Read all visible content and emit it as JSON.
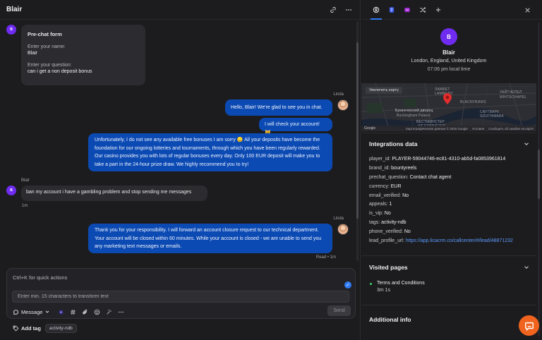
{
  "chat": {
    "title": "Blair",
    "visitor_initial": "B",
    "prechat": {
      "title": "Pre-chat form",
      "name_label": "Enter your name:",
      "name_value": "Blair",
      "question_label": "Enter your question:",
      "question_value": "can i get a non deposit bonus"
    },
    "messages": [
      {
        "sender": "Linda",
        "text": "Hello, Blair! We're glad to see you in chat."
      },
      {
        "text": "I will check your account! 😺"
      },
      {
        "text": "Unfortunately, I do not see any available free bonuses I am sorry 😞 All your deposits have become the foundation for our ongoing lotteries and tournaments, through which you have been regularly rewarded. Our casino provides you with lots of regular bonuses every day. Only 100 EUR deposit will make you to take a part in the 24-hour prize draw. We highly recommend you to try!"
      },
      {
        "sender": "Blair",
        "text": "ban my account i have a gambling problem and stop sending me messages",
        "time": "1m"
      },
      {
        "sender": "Linda",
        "text": "Thank you for your responsibility. I will forward an account closure request to our technical department. Your account will be closed within 60 minutes. While your account is closed - we are unable to send you any marketing text messages or emails.",
        "status": "Read • 1m"
      }
    ]
  },
  "composer": {
    "hint": "Ctrl+K for quick actions",
    "transform_placeholder": "Enter min. 15 characters to transform text",
    "mode_label": "Message",
    "send_label": "Send",
    "add_tag_label": "Add tag",
    "tag": "activity-ndb"
  },
  "profile": {
    "initial": "B",
    "name": "Blair",
    "location": "London, England, United Kingdom",
    "local_time": "07:06 pm local time"
  },
  "map": {
    "expand_label": "Увеличить карту",
    "labels": [
      "УАЙТЧЕПЕЛ",
      "WHITECHAPEL",
      "Букингемский дворец",
      "Buckingham Palace",
      "ВЕСТМИНСТЕР",
      "WESTMINSTER",
      "САУТВАРК",
      "SOUTHWARK",
      "BLACKFRIARS",
      "ЛАМБЕТ",
      "LAMBETH"
    ],
    "footer": [
      "Картографические данные © 2025 Google",
      "Условия",
      "Сообщить об ошибке на карте"
    ],
    "logo": "Google"
  },
  "integrations": {
    "title": "Integrations data",
    "rows": [
      {
        "key": "player_id:",
        "value": "PLAYER-59044746-ec81-4310-ab5d-fa0853961814"
      },
      {
        "key": "brand_id:",
        "value": "bountyreels"
      },
      {
        "key": "prechat_question:",
        "value": "Contact chat agent"
      },
      {
        "key": "currency:",
        "value": "EUR"
      },
      {
        "key": "email_verified:",
        "value": "No"
      },
      {
        "key": "appeals:",
        "value": "1"
      },
      {
        "key": "is_vip:",
        "value": "No"
      },
      {
        "key": "tags:",
        "value": "activity-ndb"
      },
      {
        "key": "phone_verified:",
        "value": "No"
      }
    ],
    "lead_key": "lead_profile_url:",
    "lead_url": "https://app.licacrm.co/callcenter/#/lead/48871232"
  },
  "visited": {
    "title": "Visited pages",
    "page": "Terms and Conditions",
    "duration": "3m 1s"
  },
  "additional": {
    "title": "Additional info"
  },
  "colors": {
    "accent": "#2d7af6",
    "outgoing_bubble": "#0c4ab3",
    "visitor_avatar": "#6f2cf0",
    "fab": "#f0631f",
    "online_dot": "#3ecf6e"
  }
}
